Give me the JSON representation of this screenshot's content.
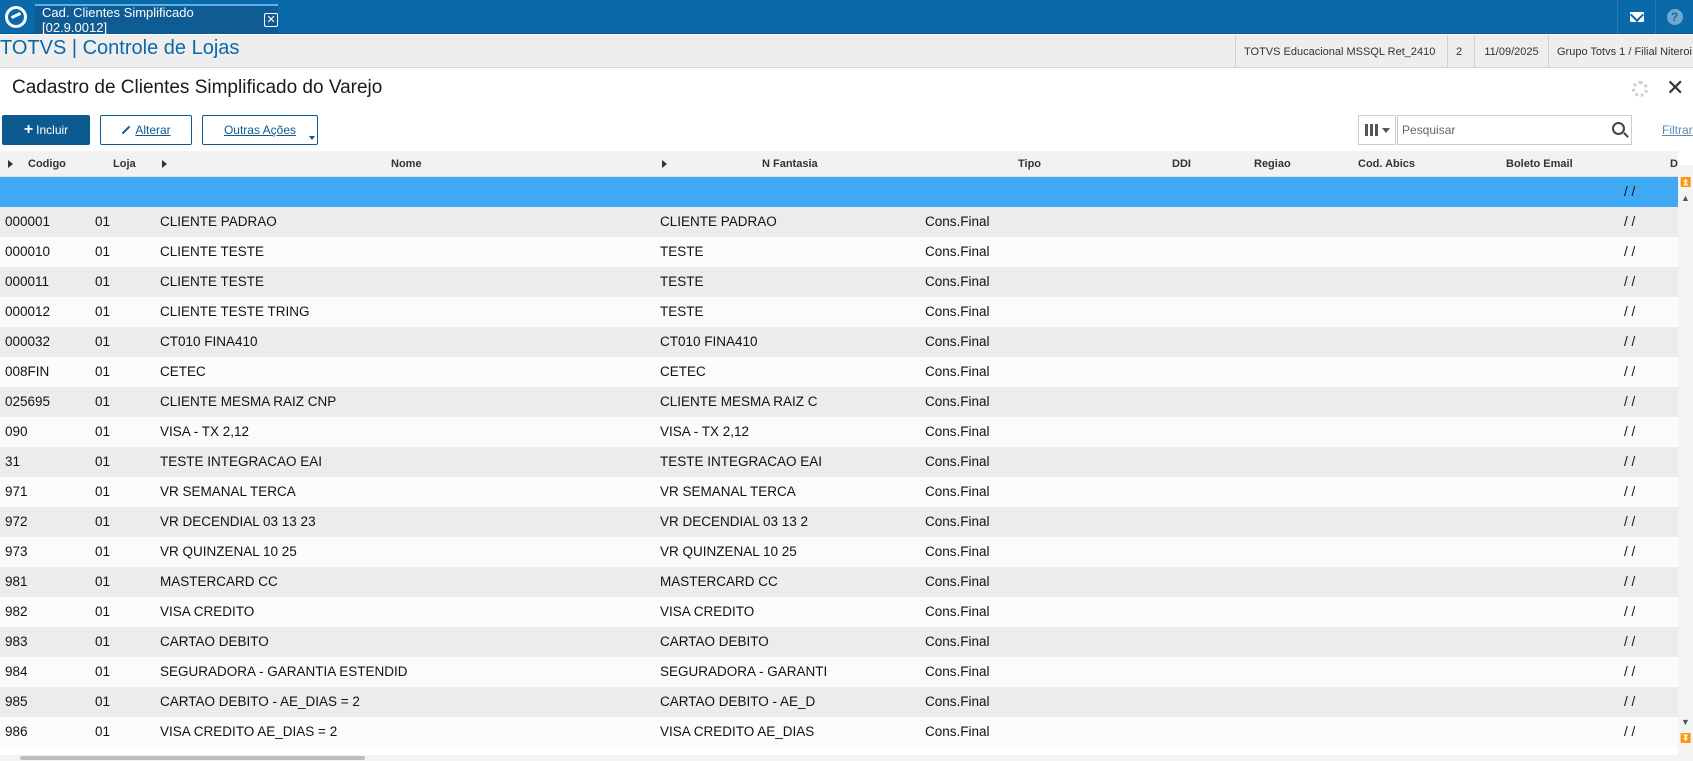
{
  "tab": {
    "title": "Cad. Clientes Simplificado [02.9.0012]"
  },
  "header": {
    "app_title": "TOTVS | Controle de Lojas",
    "environment": "TOTVS Educacional MSSQL Ret_2410",
    "session": "2",
    "date": "11/09/2025",
    "branch": "Grupo Totvs 1 / Filial Niteroi"
  },
  "page": {
    "title": "Cadastro de Clientes Simplificado do Varejo"
  },
  "toolbar": {
    "include_label": "Incluir",
    "alter_label": "Alterar",
    "other_actions_label": "Outras Ações",
    "search_placeholder": "Pesquisar",
    "filter_label": "Filtrar"
  },
  "columns": [
    "Codigo",
    "Loja",
    "Nome",
    "N Fantasia",
    "Tipo",
    "DDI",
    "Regiao",
    "Cod. Abics",
    "Boleto Email",
    "D"
  ],
  "selected_row": {
    "date": "/ /"
  },
  "rows": [
    {
      "codigo": "000001",
      "loja": "01",
      "nome": "CLIENTE PADRAO",
      "fantasia": "CLIENTE PADRAO",
      "tipo": "Cons.Final",
      "date": "/ /"
    },
    {
      "codigo": "000010",
      "loja": "01",
      "nome": "CLIENTE TESTE",
      "fantasia": "TESTE",
      "tipo": "Cons.Final",
      "date": "/ /"
    },
    {
      "codigo": "000011",
      "loja": "01",
      "nome": "CLIENTE TESTE",
      "fantasia": "TESTE",
      "tipo": "Cons.Final",
      "date": "/ /"
    },
    {
      "codigo": "000012",
      "loja": "01",
      "nome": "CLIENTE TESTE TRING",
      "fantasia": "TESTE",
      "tipo": "Cons.Final",
      "date": "/ /"
    },
    {
      "codigo": "000032",
      "loja": "01",
      "nome": "CT010 FINA410",
      "fantasia": "CT010 FINA410",
      "tipo": "Cons.Final",
      "date": "/ /"
    },
    {
      "codigo": "008FIN",
      "loja": "01",
      "nome": "CETEC",
      "fantasia": "CETEC",
      "tipo": "Cons.Final",
      "date": "/ /"
    },
    {
      "codigo": "025695",
      "loja": "01",
      "nome": "CLIENTE MESMA RAIZ CNP",
      "fantasia": "CLIENTE MESMA RAIZ C",
      "tipo": "Cons.Final",
      "date": "/ /"
    },
    {
      "codigo": "090",
      "loja": "01",
      "nome": "VISA - TX 2,12",
      "fantasia": "VISA - TX 2,12",
      "tipo": "Cons.Final",
      "date": "/ /"
    },
    {
      "codigo": "31",
      "loja": "01",
      "nome": "TESTE INTEGRACAO EAI",
      "fantasia": "TESTE INTEGRACAO EAI",
      "tipo": "Cons.Final",
      "date": "/ /"
    },
    {
      "codigo": "971",
      "loja": "01",
      "nome": "VR SEMANAL TERCA",
      "fantasia": "VR SEMANAL TERCA",
      "tipo": "Cons.Final",
      "date": "/ /"
    },
    {
      "codigo": "972",
      "loja": "01",
      "nome": "VR DECENDIAL 03 13 23",
      "fantasia": "VR DECENDIAL 03 13 2",
      "tipo": "Cons.Final",
      "date": "/ /"
    },
    {
      "codigo": "973",
      "loja": "01",
      "nome": "VR QUINZENAL 10 25",
      "fantasia": "VR QUINZENAL 10 25",
      "tipo": "Cons.Final",
      "date": "/ /"
    },
    {
      "codigo": "981",
      "loja": "01",
      "nome": "MASTERCARD CC",
      "fantasia": "MASTERCARD CC",
      "tipo": "Cons.Final",
      "date": "/ /"
    },
    {
      "codigo": "982",
      "loja": "01",
      "nome": "VISA CREDITO",
      "fantasia": "VISA CREDITO",
      "tipo": "Cons.Final",
      "date": "/ /"
    },
    {
      "codigo": "983",
      "loja": "01",
      "nome": "CARTAO DEBITO",
      "fantasia": "CARTAO DEBITO",
      "tipo": "Cons.Final",
      "date": "/ /"
    },
    {
      "codigo": "984",
      "loja": "01",
      "nome": "SEGURADORA - GARANTIA ESTENDID",
      "fantasia": "SEGURADORA - GARANTI",
      "tipo": "Cons.Final",
      "date": "/ /"
    },
    {
      "codigo": "985",
      "loja": "01",
      "nome": "CARTAO DEBITO - AE_DIAS = 2",
      "fantasia": "CARTAO DEBITO - AE_D",
      "tipo": "Cons.Final",
      "date": "/ /"
    },
    {
      "codigo": "986",
      "loja": "01",
      "nome": "VISA CREDITO AE_DIAS = 2",
      "fantasia": "VISA CREDITO AE_DIAS",
      "tipo": "Cons.Final",
      "date": "/ /"
    }
  ],
  "icons": {
    "logo": "totvs-logo-icon",
    "tab_close": "close-icon",
    "mail": "mail-icon",
    "help": "help-icon",
    "gear": "gear-icon",
    "window_close": "close-icon",
    "plus": "plus-icon",
    "pencil": "pencil-icon",
    "columns": "columns-icon",
    "search": "search-icon"
  },
  "colors": {
    "topbar": "#0a6aa9",
    "primary": "#0c5a8f",
    "selected_row": "#3fa9f5",
    "header_title": "#0a6aa9"
  }
}
